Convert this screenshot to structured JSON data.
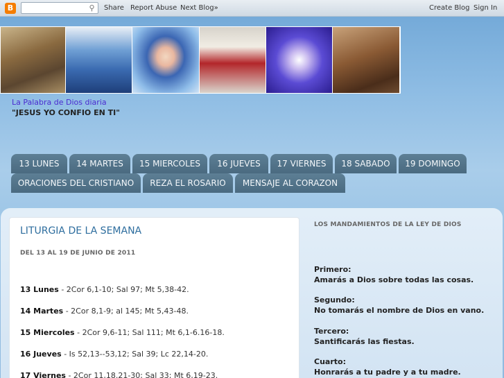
{
  "navbar": {
    "logo": "B",
    "search_placeholder": "",
    "search_icon": "search-icon",
    "share": "Share",
    "report_abuse": "Report Abuse",
    "next_blog": "Next Blog»",
    "create_blog": "Create Blog",
    "sign_in": "Sign In"
  },
  "header": {
    "title": "La Palabra de Dios diaria",
    "description": "\"JESUS YO CONFIO EN TI\""
  },
  "tabs": {
    "row1": [
      "13 LUNES",
      "14 MARTES",
      "15 MIERCOLES",
      "16 JUEVES",
      "17 VIERNES",
      "18 SABADO",
      "19 DOMINGO"
    ],
    "row2": [
      "ORACIONES DEL CRISTIANO",
      "REZA EL ROSARIO",
      "MENSAJE AL CORAZON"
    ]
  },
  "post": {
    "title": "LITURGIA DE LA SEMANA",
    "date": "DEL 13 AL 19 DE JUNIO DE 2011",
    "readings": [
      {
        "day": "13 Lunes",
        "text": " - 2Cor 6,1-10; Sal 97; Mt 5,38-42."
      },
      {
        "day": "14 Martes",
        "text": " - 2Cor 8,1-9; al 145; Mt 5,43-48."
      },
      {
        "day": "15 Miercoles",
        "text": " - 2Cor 9,6-11; Sal 111; Mt 6,1-6.16-18."
      },
      {
        "day": "16 Jueves",
        "text": " - Is 52,13--53,12; Sal 39; Lc 22,14-20."
      },
      {
        "day": "17 Viernes",
        "text": " - 2Cor 11,18.21-30; Sal 33; Mt 6,19-23."
      }
    ]
  },
  "sidebar": {
    "title": "LOS MANDAMIENTOS DE LA LEY DE DIOS",
    "commandments": [
      {
        "label": "Primero:",
        "text": "Amarás a Dios sobre todas las cosas."
      },
      {
        "label": "Segundo:",
        "text": "No tomarás el nombre de Dios en vano."
      },
      {
        "label": "Tercero:",
        "text": "Santificarás las fiestas."
      },
      {
        "label": "Cuarto:",
        "text": "Honrarás a tu padre y a tu madre."
      }
    ]
  }
}
